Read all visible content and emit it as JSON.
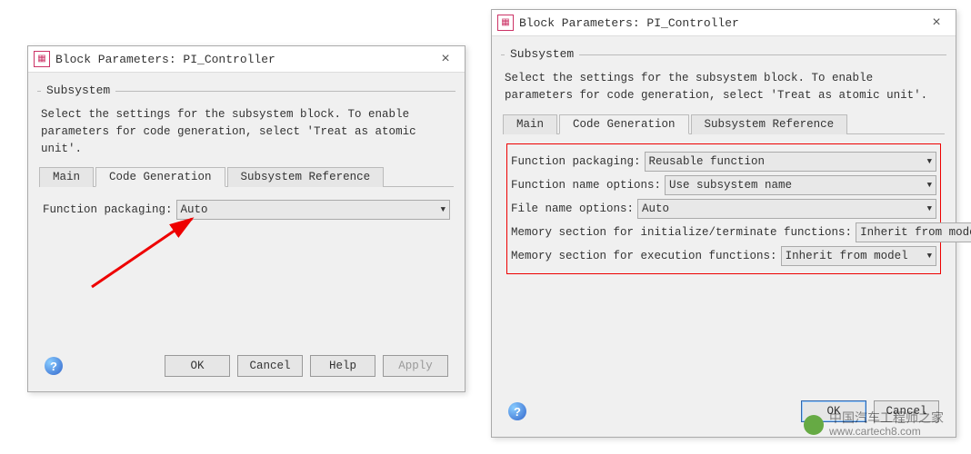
{
  "dialog_title": "Block Parameters: PI_Controller",
  "section_label": "Subsystem",
  "description": "Select the settings for the subsystem block. To enable parameters for code generation, select 'Treat as atomic unit'.",
  "tabs": {
    "main": "Main",
    "codegen": "Code Generation",
    "subref": "Subsystem Reference"
  },
  "left": {
    "fields": {
      "fn_pkg_label": "Function packaging:",
      "fn_pkg_value": "Auto"
    }
  },
  "right": {
    "fields": {
      "fn_pkg_label": "Function packaging:",
      "fn_pkg_value": "Reusable function",
      "fn_name_label": "Function name options:",
      "fn_name_value": "Use subsystem name",
      "file_name_label": "File name options:",
      "file_name_value": "Auto",
      "mem_init_label": "Memory section for initialize/terminate functions:",
      "mem_init_value": "Inherit from model",
      "mem_exec_label": "Memory section for execution functions:",
      "mem_exec_value": "Inherit from model"
    }
  },
  "buttons": {
    "ok": "OK",
    "cancel": "Cancel",
    "help": "Help",
    "apply": "Apply"
  },
  "watermark": {
    "text1": "中国汽车工程师之家",
    "text2": "www.cartech8.com"
  }
}
